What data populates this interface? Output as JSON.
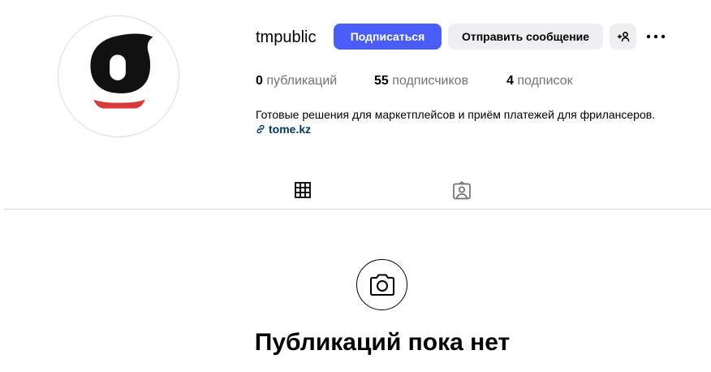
{
  "profile": {
    "username": "tmpublic",
    "follow_label": "Подписаться",
    "message_label": "Отправить сообщение",
    "stats": {
      "posts_count": "0",
      "posts_label": "публикаций",
      "followers_count": "55",
      "followers_label": "подписчиков",
      "following_count": "4",
      "following_label": "подписок"
    },
    "bio": "Готовые решения для маркетплейсов и приём платежей для фрилансеров.",
    "link": "tome.kz"
  },
  "tabs": [
    {
      "icon": "grid-icon",
      "active": true
    },
    {
      "icon": "tagged-icon",
      "active": false
    }
  ],
  "empty_state": {
    "icon": "camera-icon",
    "title": "Публикаций пока нет"
  },
  "colors": {
    "follow_button": "#4a5df9",
    "secondary_button": "#efeff3",
    "link": "#00376b",
    "muted_text": "#737373",
    "logo_red": "#d63a3a"
  }
}
